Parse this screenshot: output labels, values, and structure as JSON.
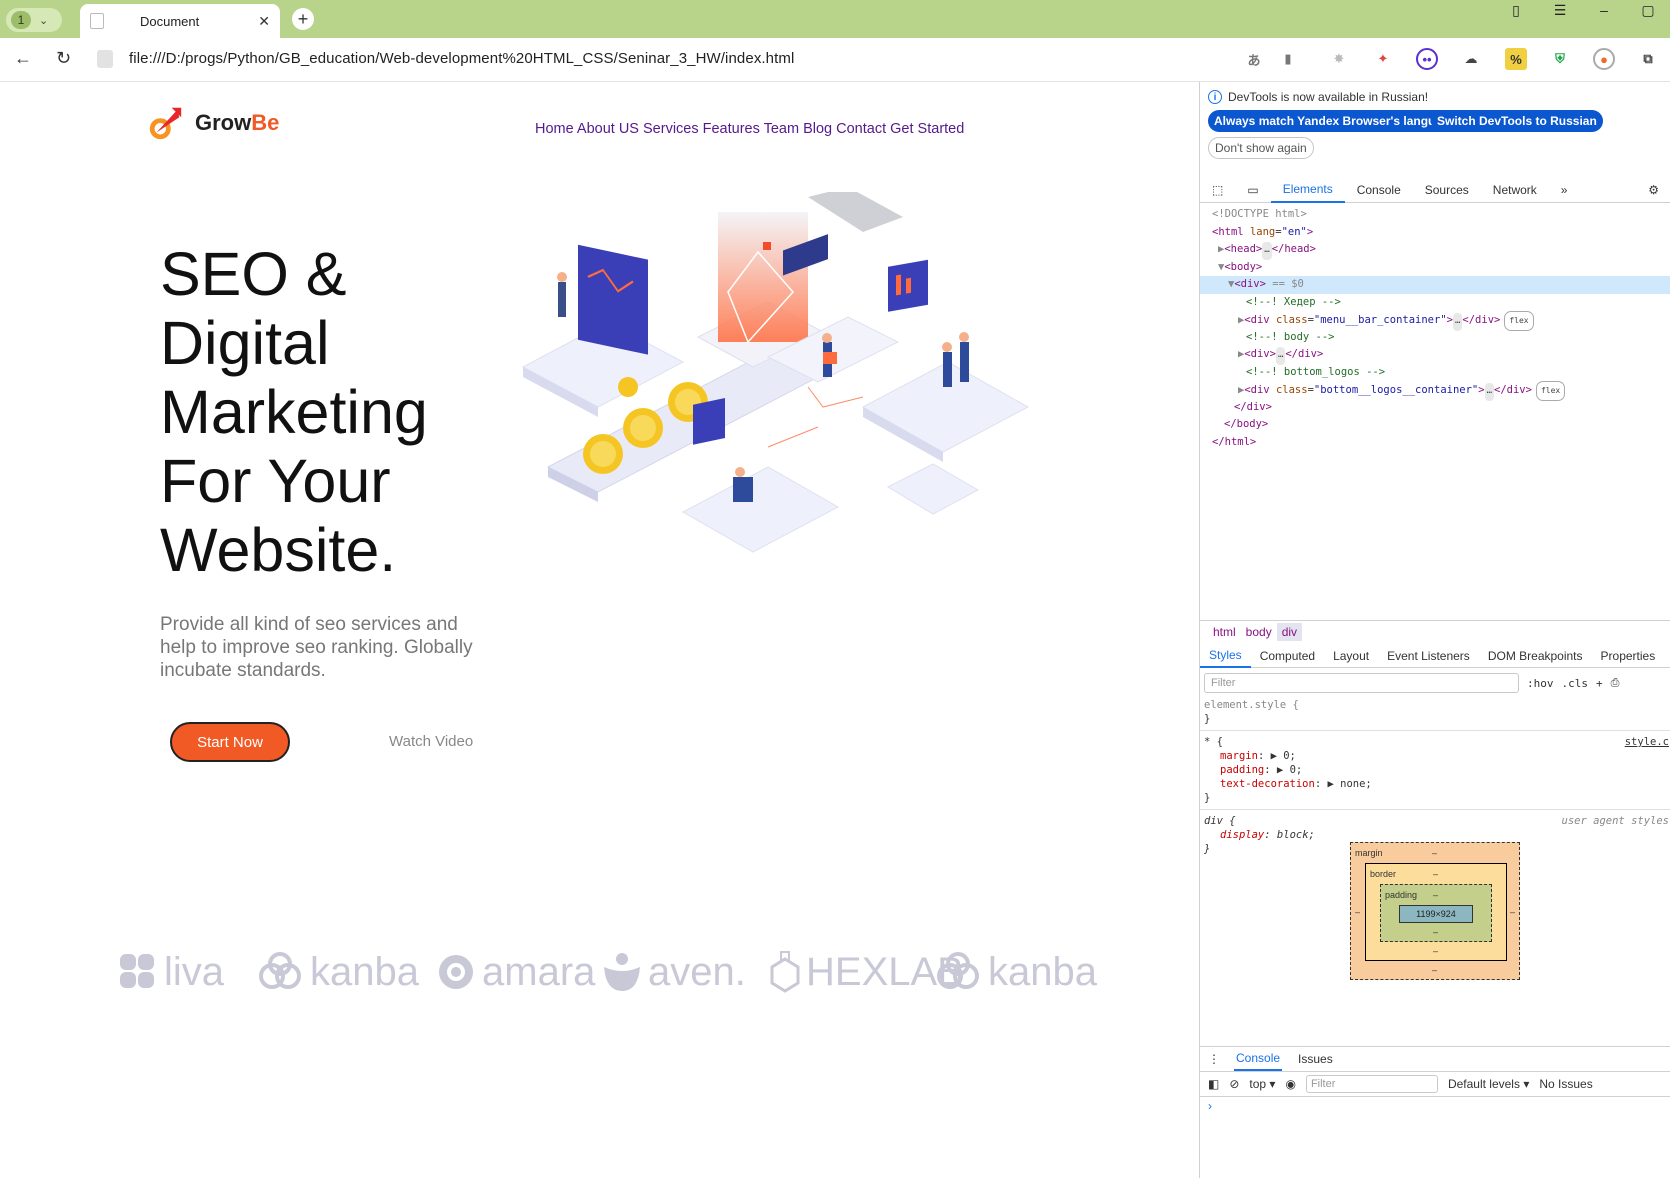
{
  "browser": {
    "tab_count": "1",
    "tab_title": "Document",
    "url": "file:///D:/progs/Python/GB_education/Web-development%20HTML_CSS/Seninar_3_HW/index.html"
  },
  "page": {
    "logo": {
      "text_a": "Grow",
      "text_b": "Be"
    },
    "menu": "Home About US Services Features Team Blog Contact Get Started",
    "hero_lines": [
      "SEO &",
      "Digital",
      "Marketing",
      "For Your",
      "Website."
    ],
    "description": "Provide all kind of seo services and help to improve seo ranking. Globally incubate standards.",
    "start_button": "Start Now",
    "watch_video": "Watch Video",
    "partners": [
      "liva",
      "kanba",
      "amara",
      "aven.",
      "HEXLAB",
      "kanba"
    ]
  },
  "devtools": {
    "notice": "DevTools is now available in Russian!",
    "btn_match": "Always match Yandex Browser's language",
    "btn_switch": "Switch DevTools to Russian",
    "btn_dont": "Don't show again",
    "tabs": [
      "Elements",
      "Console",
      "Sources",
      "Network"
    ],
    "tree": {
      "doctype": "<!DOCTYPE html>",
      "html_open": "<html",
      "lang_attr": "lang",
      "lang_val": "\"en\"",
      "head": "<head>",
      "head_close": "</head>",
      "body": "<body>",
      "div": "<div>",
      "div_marker": " == $0",
      "c1": "<!--! Хедер -->",
      "menu_div_class": "\"menu__bar_container\"",
      "c2": "<!--! body -->",
      "c3": "<!--! bottom_logos -->",
      "bottom_div_class": "\"bottom__logos__container\"",
      "div_close": "</div>",
      "body_close": "</body>",
      "html_close": "</html>",
      "flex": "flex"
    },
    "crumbs": [
      "html",
      "body",
      "div"
    ],
    "style_tabs": [
      "Styles",
      "Computed",
      "Layout",
      "Event Listeners",
      "DOM Breakpoints",
      "Properties"
    ],
    "filter_placeholder": "Filter",
    "hov": ":hov",
    "cls": ".cls",
    "rules": {
      "element_style": "element.style {",
      "star": "* {",
      "star_source": "style.c",
      "margin": "margin",
      "margin_val": "0;",
      "padding": "padding",
      "padding_val": "0;",
      "text_dec": "text-decoration",
      "text_dec_val": "none;",
      "div_sel": "div {",
      "ua": "user agent styles",
      "display": "display",
      "display_val": "block;",
      "close": "}"
    },
    "boxmodel": {
      "margin": "margin",
      "border": "border",
      "padding": "padding",
      "content": "1199×924",
      "dash": "–"
    },
    "drawer_tabs": [
      "Console",
      "Issues"
    ],
    "console_context": "top",
    "console_filter": "Filter",
    "levels": "Default levels",
    "issues": "No Issues"
  }
}
